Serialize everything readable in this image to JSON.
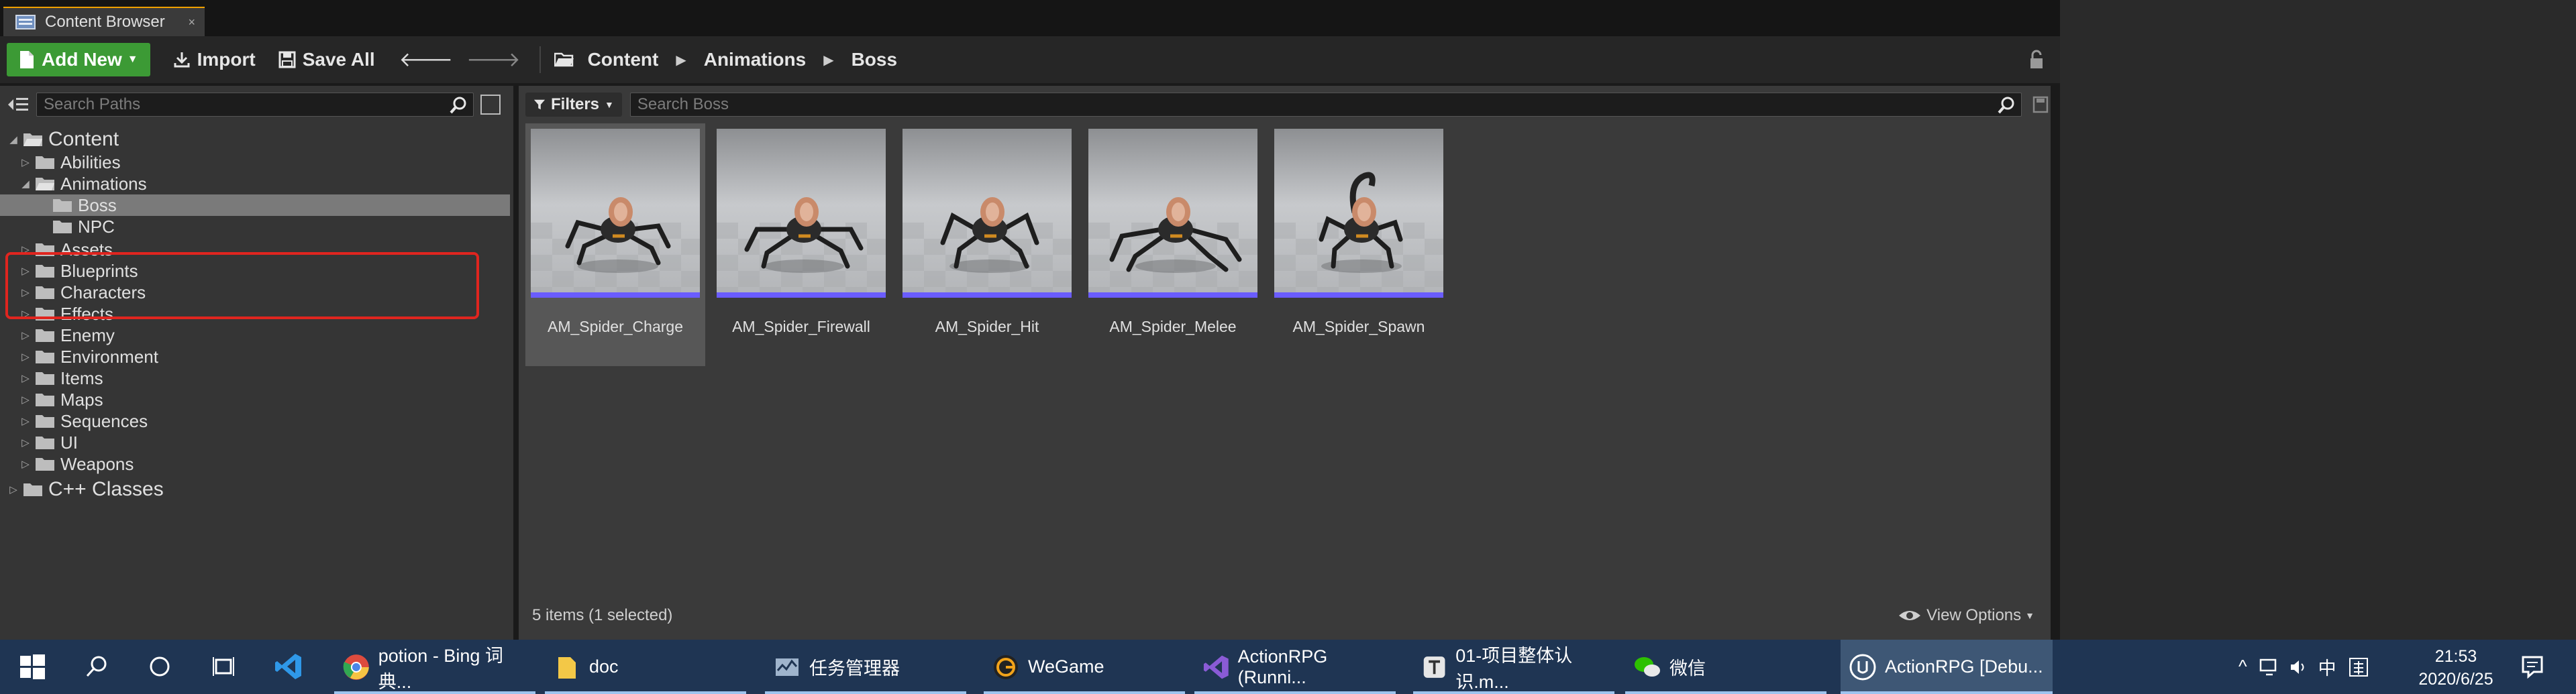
{
  "window": {
    "tab_title": "Content Browser",
    "tab_close": "×"
  },
  "toolbar": {
    "add_new_label": "Add New",
    "import_label": "Import",
    "save_all_label": "Save All",
    "breadcrumbs": [
      "Content",
      "Animations",
      "Boss"
    ]
  },
  "sources": {
    "search_placeholder": "Search Paths",
    "tree": [
      {
        "label": "Content",
        "level": 0,
        "expanded": true,
        "selected": false
      },
      {
        "label": "Abilities",
        "level": 1,
        "expanded": false,
        "selected": false
      },
      {
        "label": "Animations",
        "level": 1,
        "expanded": true,
        "selected": false
      },
      {
        "label": "Boss",
        "level": 2,
        "expanded": false,
        "selected": true
      },
      {
        "label": "NPC",
        "level": 2,
        "expanded": false,
        "selected": false
      },
      {
        "label": "Assets",
        "level": 1,
        "expanded": false,
        "selected": false
      },
      {
        "label": "Blueprints",
        "level": 1,
        "expanded": false,
        "selected": false
      },
      {
        "label": "Characters",
        "level": 1,
        "expanded": false,
        "selected": false
      },
      {
        "label": "Effects",
        "level": 1,
        "expanded": false,
        "selected": false
      },
      {
        "label": "Enemy",
        "level": 1,
        "expanded": false,
        "selected": false
      },
      {
        "label": "Environment",
        "level": 1,
        "expanded": false,
        "selected": false
      },
      {
        "label": "Items",
        "level": 1,
        "expanded": false,
        "selected": false
      },
      {
        "label": "Maps",
        "level": 1,
        "expanded": false,
        "selected": false
      },
      {
        "label": "Sequences",
        "level": 1,
        "expanded": false,
        "selected": false
      },
      {
        "label": "UI",
        "level": 1,
        "expanded": false,
        "selected": false
      },
      {
        "label": "Weapons",
        "level": 1,
        "expanded": false,
        "selected": false
      },
      {
        "label": "C++ Classes",
        "level": 0,
        "expanded": false,
        "selected": false
      }
    ]
  },
  "assets": {
    "filters_label": "Filters",
    "search_placeholder": "Search Boss",
    "items": [
      {
        "name": "AM_Spider_Charge",
        "selected": true
      },
      {
        "name": "AM_Spider_Firewall",
        "selected": false
      },
      {
        "name": "AM_Spider_Hit",
        "selected": false
      },
      {
        "name": "AM_Spider_Melee",
        "selected": false
      },
      {
        "name": "AM_Spider_Spawn",
        "selected": false
      }
    ],
    "status": "5 items (1 selected)",
    "view_options_label": "View Options"
  },
  "colors": {
    "add_new": "#3c9a35",
    "highlight_box": "#e0251f",
    "thumb_bar": "#6a5cff",
    "taskbar": "#1f3553"
  },
  "taskbar": {
    "items": [
      {
        "label": "potion - Bing 词典...",
        "icon": "chrome-icon"
      },
      {
        "label": "doc",
        "icon": "folder-icon"
      },
      {
        "label": "任务管理器",
        "icon": "task-manager-icon"
      },
      {
        "label": "WeGame",
        "icon": "wegame-icon"
      },
      {
        "label": "ActionRPG (Runni...",
        "icon": "visual-studio-icon"
      },
      {
        "label": "01-项目整体认识.m...",
        "icon": "typora-icon"
      },
      {
        "label": "微信",
        "icon": "wechat-icon"
      },
      {
        "label": "ActionRPG [Debu...",
        "icon": "unreal-icon"
      }
    ],
    "ime_label": "中",
    "time": "21:53",
    "date": "2020/6/25"
  }
}
